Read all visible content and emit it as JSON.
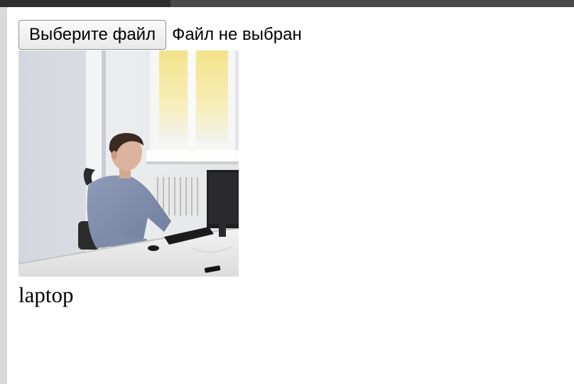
{
  "file_input": {
    "button_label": "Выберите файл",
    "status": "Файл не выбран"
  },
  "result": {
    "label": "laptop"
  }
}
